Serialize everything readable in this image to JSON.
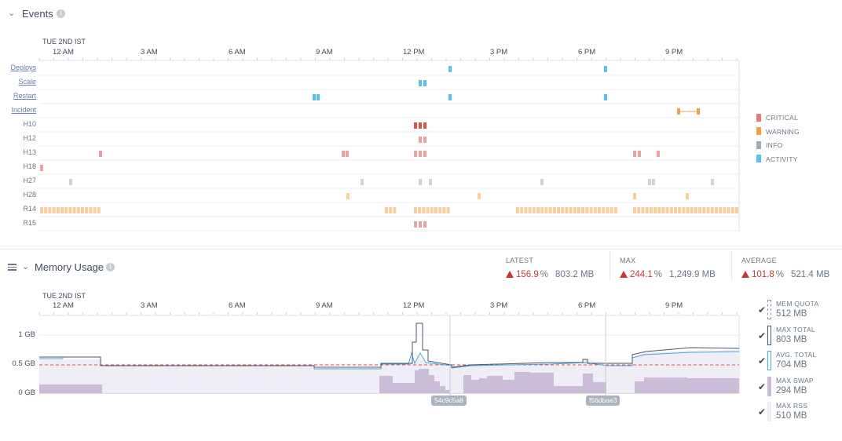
{
  "events": {
    "title": "Events",
    "date": "TUE 2ND IST",
    "ticks": [
      "12 AM",
      "3 AM",
      "6 AM",
      "9 AM",
      "12 PM",
      "3 PM",
      "6 PM",
      "9 PM"
    ],
    "rows": [
      {
        "label": "Deploys",
        "link": true
      },
      {
        "label": "Scale",
        "link": true
      },
      {
        "label": "Restart",
        "link": true
      },
      {
        "label": "Incident",
        "link": true
      },
      {
        "label": "H10",
        "link": false
      },
      {
        "label": "H12",
        "link": false
      },
      {
        "label": "H13",
        "link": false
      },
      {
        "label": "H18",
        "link": false
      },
      {
        "label": "H27",
        "link": false
      },
      {
        "label": "H28",
        "link": false
      },
      {
        "label": "R14",
        "link": false
      },
      {
        "label": "R15",
        "link": false
      }
    ],
    "legend": [
      {
        "label": "CRITICAL",
        "color": "#e07b78"
      },
      {
        "label": "WARNING",
        "color": "#f5a04a"
      },
      {
        "label": "INFO",
        "color": "#a3aab8"
      },
      {
        "label": "ACTIVITY",
        "color": "#5bc0eb"
      }
    ]
  },
  "memory": {
    "title": "Memory Usage",
    "date": "TUE 2ND IST",
    "ticks": [
      "12 AM",
      "3 AM",
      "6 AM",
      "9 AM",
      "12 PM",
      "3 PM",
      "6 PM",
      "9 PM"
    ],
    "yticks": [
      "1 GB",
      "0.5 GB",
      "0 GB"
    ],
    "stats": [
      {
        "label": "LATEST",
        "pct": "156.9",
        "pct_sign": "%",
        "value": "803.2 MB"
      },
      {
        "label": "MAX",
        "pct": "244.1",
        "pct_sign": "%",
        "value": "1,249.9 MB"
      },
      {
        "label": "AVERAGE",
        "pct": "101.8",
        "pct_sign": "%",
        "value": "521.4 MB"
      }
    ],
    "releases": [
      "54c9c5a8",
      "f56dbae3"
    ],
    "legend": [
      {
        "name": "MEM QUOTA",
        "value": "512",
        "unit": "MB",
        "style": "dashed"
      },
      {
        "name": "MAX TOTAL",
        "value": "803",
        "unit": "MB",
        "style": "outline-dark"
      },
      {
        "name": "AVG. TOTAL",
        "value": "704",
        "unit": "MB",
        "style": "outline-blue"
      },
      {
        "name": "MAX SWAP",
        "value": "294",
        "unit": "MB",
        "style": "fill-purple"
      },
      {
        "name": "MAX RSS",
        "value": "510",
        "unit": "MB",
        "style": "fill-light"
      }
    ],
    "check_glyph": "✔"
  }
}
